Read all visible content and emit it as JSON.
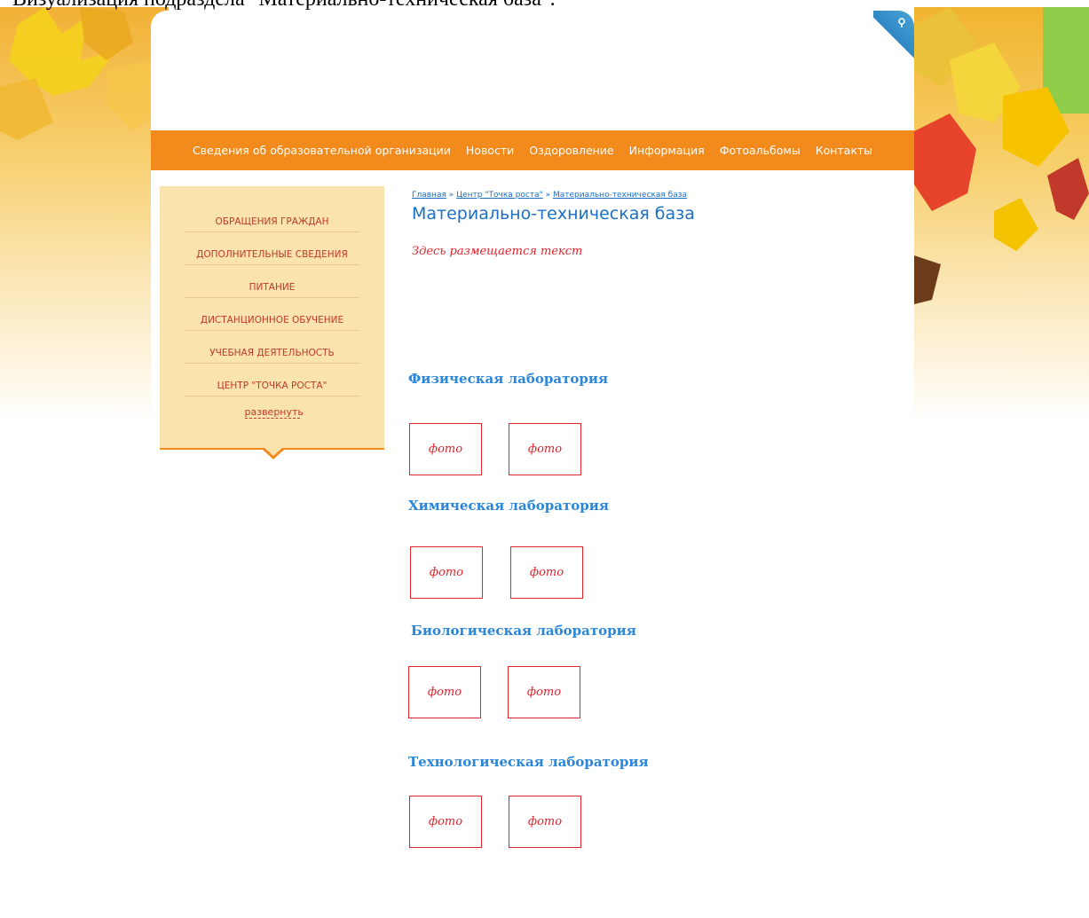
{
  "caption": "Визуализация подраздела \"Материально-техническая база\".",
  "topnav": {
    "items": [
      "Сведения об образовательной организации",
      "Новости",
      "Оздоровление",
      "Информация",
      "Фотоальбомы",
      "Контакты"
    ]
  },
  "sidebar": {
    "items": [
      "Обращения граждан",
      "Дополнительные сведения",
      "Питание",
      "Дистанционное обучение",
      "Учебная деятельность",
      "Центр \"Точка роста\""
    ],
    "expand_label": "развернуть"
  },
  "breadcrumb": {
    "items": [
      "Главная",
      "Центр \"Точка роста\"",
      "Материально-техническая база"
    ],
    "separator": "»"
  },
  "page_title": "Материально-техническая база",
  "placeholder_text": "Здесь размещается текст",
  "labs": [
    {
      "title": "Физическая лаборатория",
      "photos": [
        "фото",
        "фото"
      ]
    },
    {
      "title": "Химическая лаборатория",
      "photos": [
        "фото",
        "фото"
      ]
    },
    {
      "title": "Биологическая лаборатория",
      "photos": [
        "фото",
        "фото"
      ]
    },
    {
      "title": "Технологическая лаборатория",
      "photos": [
        "фото",
        "фото"
      ]
    }
  ],
  "colors": {
    "nav_orange": "#f28a1c",
    "sidebar_bg": "#fae3ad",
    "link_blue": "#1a6fc4",
    "accent_red": "#e0232c"
  },
  "icons": [
    "corner-accessibility-icon",
    "autumn-leaves-decoration"
  ]
}
